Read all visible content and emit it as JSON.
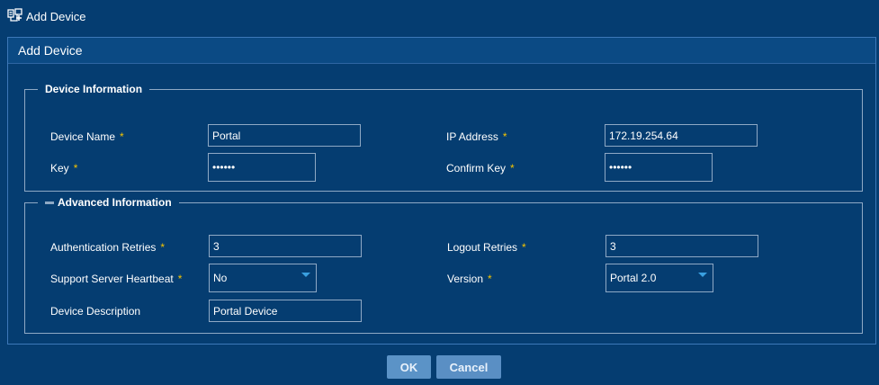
{
  "header": {
    "title": "Add Device",
    "icon": "device-add-icon"
  },
  "panel": {
    "title": "Add Device"
  },
  "required_mark": "*",
  "device_info": {
    "legend": "Device Information",
    "device_name": {
      "label": "Device Name",
      "value": "Portal"
    },
    "ip_address": {
      "label": "IP Address",
      "value": "172.19.254.64"
    },
    "key": {
      "label": "Key",
      "value": "••••••"
    },
    "confirm_key": {
      "label": "Confirm Key",
      "value": "••••••"
    }
  },
  "advanced_info": {
    "legend": "Advanced Information",
    "auth_retries": {
      "label": "Authentication Retries",
      "value": "3"
    },
    "logout_retries": {
      "label": "Logout Retries",
      "value": "3"
    },
    "heartbeat": {
      "label": "Support Server Heartbeat",
      "value": "No"
    },
    "version": {
      "label": "Version",
      "value": "Portal 2.0"
    },
    "description": {
      "label": "Device Description",
      "value": "Portal Device"
    }
  },
  "buttons": {
    "ok": "OK",
    "cancel": "Cancel"
  },
  "colors": {
    "background": "#053d71",
    "border": "#8fa9c5",
    "required": "#f5c400",
    "button": "#5b93c7"
  }
}
